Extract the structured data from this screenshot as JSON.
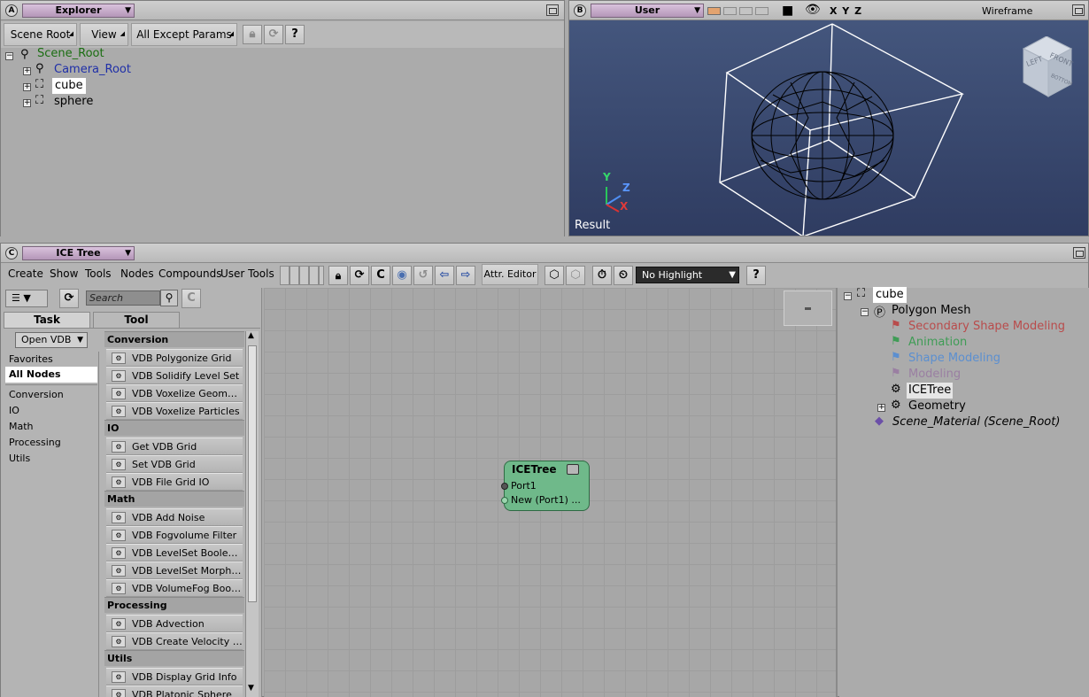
{
  "explorer": {
    "letter": "A",
    "view_name": "Explorer",
    "toolbar": {
      "scope": "Scene Root",
      "view": "View",
      "filter": "All Except Params",
      "help": "?"
    },
    "tree": [
      {
        "label": "Scene_Root",
        "color": "#1b6e12"
      },
      {
        "label": "Camera_Root",
        "color": "#1f2fa8"
      },
      {
        "label": "cube",
        "color": "#000000"
      },
      {
        "label": "sphere",
        "color": "#000000"
      }
    ]
  },
  "viewport": {
    "letter": "B",
    "camera": "User",
    "axes_label": "X Y Z",
    "mode": "Wireframe",
    "result_label": "Result",
    "axis": {
      "y": "Y",
      "z": "Z",
      "x": "X"
    },
    "cube_labels": {
      "left": "LEFT",
      "front": "FRONT",
      "bottom": "BOTTOM"
    }
  },
  "ice": {
    "letter": "C",
    "view_name": "ICE Tree",
    "menu": [
      "Create",
      "Show",
      "Tools",
      "Nodes",
      "Compounds",
      "User Tools"
    ],
    "attr_editor": "Attr. Editor",
    "highlight": "No Highlight",
    "help": "?",
    "search_placeholder": "Search",
    "tabs": {
      "task": "Task",
      "tool": "Tool"
    },
    "open_vdb": "Open VDB",
    "side": [
      "Favorites",
      "All Nodes",
      "Conversion",
      "IO",
      "Math",
      "Processing",
      "Utils"
    ],
    "categories": [
      {
        "name": "Conversion",
        "items": [
          "VDB Polygonize Grid",
          "VDB Solidify Level Set",
          "VDB Voxelize Geometry",
          "VDB Voxelize Particles"
        ]
      },
      {
        "name": "IO",
        "items": [
          "Get VDB Grid",
          "Set VDB Grid",
          "VDB File Grid IO"
        ]
      },
      {
        "name": "Math",
        "items": [
          "VDB Add Noise",
          "VDB Fogvolume Filter",
          "VDB LevelSet Boolean Opera...",
          "VDB LevelSet Morphology",
          "VDB VolumeFog Boolean Oper..."
        ]
      },
      {
        "name": "Processing",
        "items": [
          "VDB Advection",
          "VDB Create Velocity Field"
        ]
      },
      {
        "name": "Utils",
        "items": [
          "VDB Display Grid Info",
          "VDB Platonic Sphere"
        ]
      }
    ],
    "node": {
      "title": "ICETree",
      "port1": "Port1",
      "port2": "New (Port1) ..."
    },
    "right_tree": [
      {
        "label": "cube",
        "color": "#000000"
      },
      {
        "label": "Polygon Mesh",
        "color": "#000000"
      },
      {
        "label": "Secondary Shape Modeling",
        "color": "#b94b4b"
      },
      {
        "label": "Animation",
        "color": "#3f9c56"
      },
      {
        "label": "Shape Modeling",
        "color": "#5b8fd0"
      },
      {
        "label": "Modeling",
        "color": "#9a7fa2"
      },
      {
        "label": "ICETree",
        "color": "#000000"
      },
      {
        "label": "Geometry",
        "color": "#000000"
      },
      {
        "label": "Scene_Material (Scene_Root)",
        "color": "#000000"
      }
    ]
  }
}
